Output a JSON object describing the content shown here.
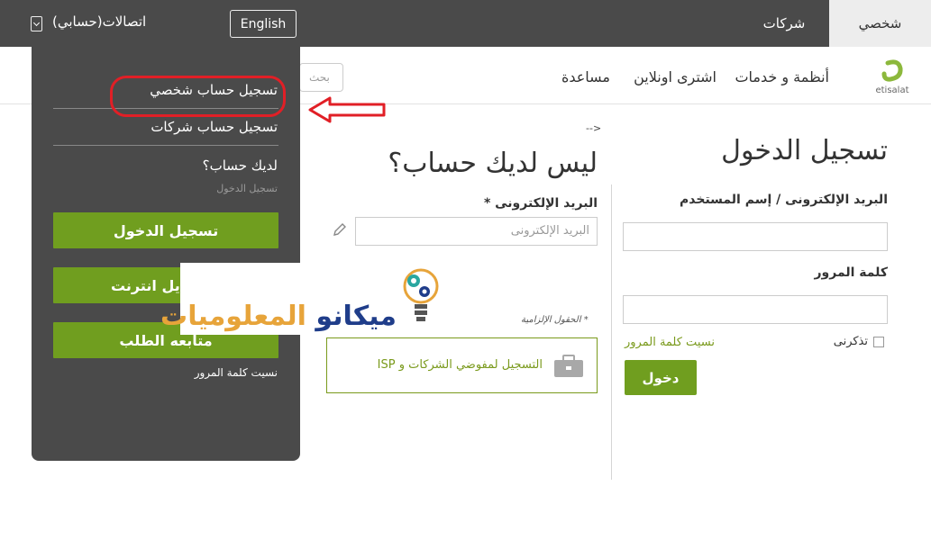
{
  "topbar": {
    "tab_personal": "شخصي",
    "tab_business": "شركات",
    "english_button": "English",
    "account_label": "اتصالات(حسابي)"
  },
  "nav": {
    "logo_text": "etisalat",
    "items": [
      "أنظمة و خدمات",
      "اشترى اونلاين",
      "مساعدة"
    ],
    "search_placeholder": "بحث"
  },
  "login": {
    "title": "تسجيل الدخول",
    "username_label": "البريد الإلكترونى / إسم المستخدم",
    "username_value": "",
    "password_label": "كلمة المرور",
    "password_value": "",
    "remember_label": "تذكرنى",
    "forgot_link": "نسيت كلمة المرور",
    "submit": "دخول"
  },
  "register": {
    "arrow": "-->",
    "title": "ليس لديك حساب؟",
    "email_label": "البريد الإلكترونى *",
    "email_placeholder": "البريد الإلكترونى",
    "required_note": "* الحقول الإلزامية",
    "isp_text": "التسجيل لمفوضي الشركات و ISP"
  },
  "dropdown": {
    "register_personal": "تسجيل حساب شخصي",
    "register_business": "تسجيل حساب شركات",
    "have_account": "لديك حساب؟",
    "login_sub": "تسجيل الدخول",
    "btn_login": "تسجيل الدخول",
    "btn_mobile": "للموبايل انترنت",
    "btn_track": "متابعه الطلب",
    "forgot": "نسيت كلمة المرور"
  },
  "watermark": {
    "part1": "ميكانو",
    "part2": "المعلوميات"
  },
  "colors": {
    "brand_green": "#709e1f",
    "dark_bar": "#4a4a4a",
    "annotation_red": "#e11f26"
  }
}
